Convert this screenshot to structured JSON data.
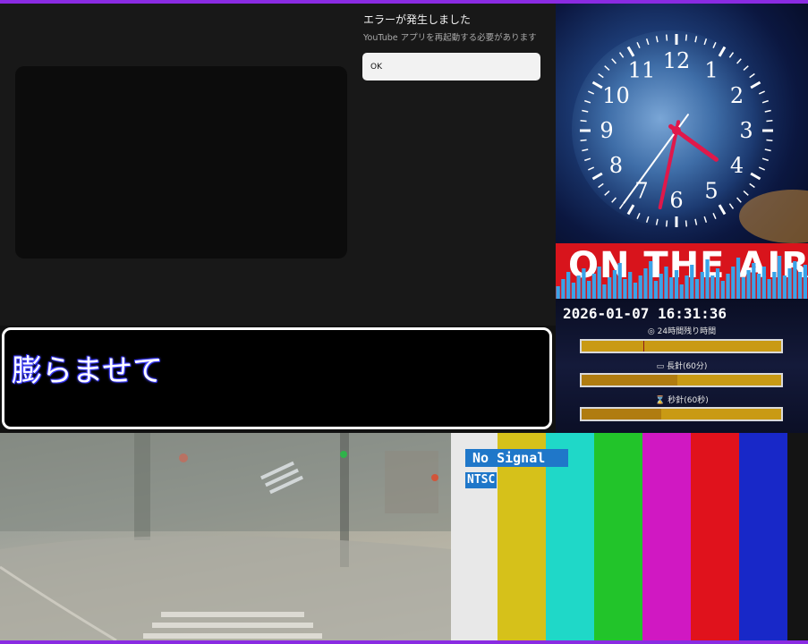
{
  "youtube_error": {
    "title": "エラーが発生しました",
    "message": "YouTube アプリを再起動する必要があります",
    "ok_label": "OK"
  },
  "clock": {
    "numerals": [
      "12",
      "1",
      "2",
      "3",
      "4",
      "5",
      "6",
      "7",
      "8",
      "9",
      "10",
      "11"
    ],
    "hour_hand_color": "#e0184a",
    "minute_hand_color": "#e0184a",
    "second_hand_color": "#ffffff"
  },
  "on_air": {
    "text": "ON THE AIR",
    "background": "#d8141c",
    "bar_color": "#3aa3e8"
  },
  "timer": {
    "datetime": "2026-01-07 16:31:36",
    "day_label": "24時間残り時間",
    "minute_label": "長針(60分)",
    "second_label": "秒針(60秒)",
    "day_fraction": 0.31,
    "minute_fraction": 0.48,
    "second_fraction": 0.4,
    "bar_color": "#c99a14"
  },
  "caption": {
    "text": "膨らませて"
  },
  "color_bars": {
    "colors": [
      "#e8e8e8",
      "#d6c11a",
      "#1fd8c8",
      "#22c42a",
      "#d018c2",
      "#e0121c",
      "#1828c8",
      "#141414"
    ],
    "no_signal_label": "No Signal",
    "format_label": "NTSC"
  }
}
